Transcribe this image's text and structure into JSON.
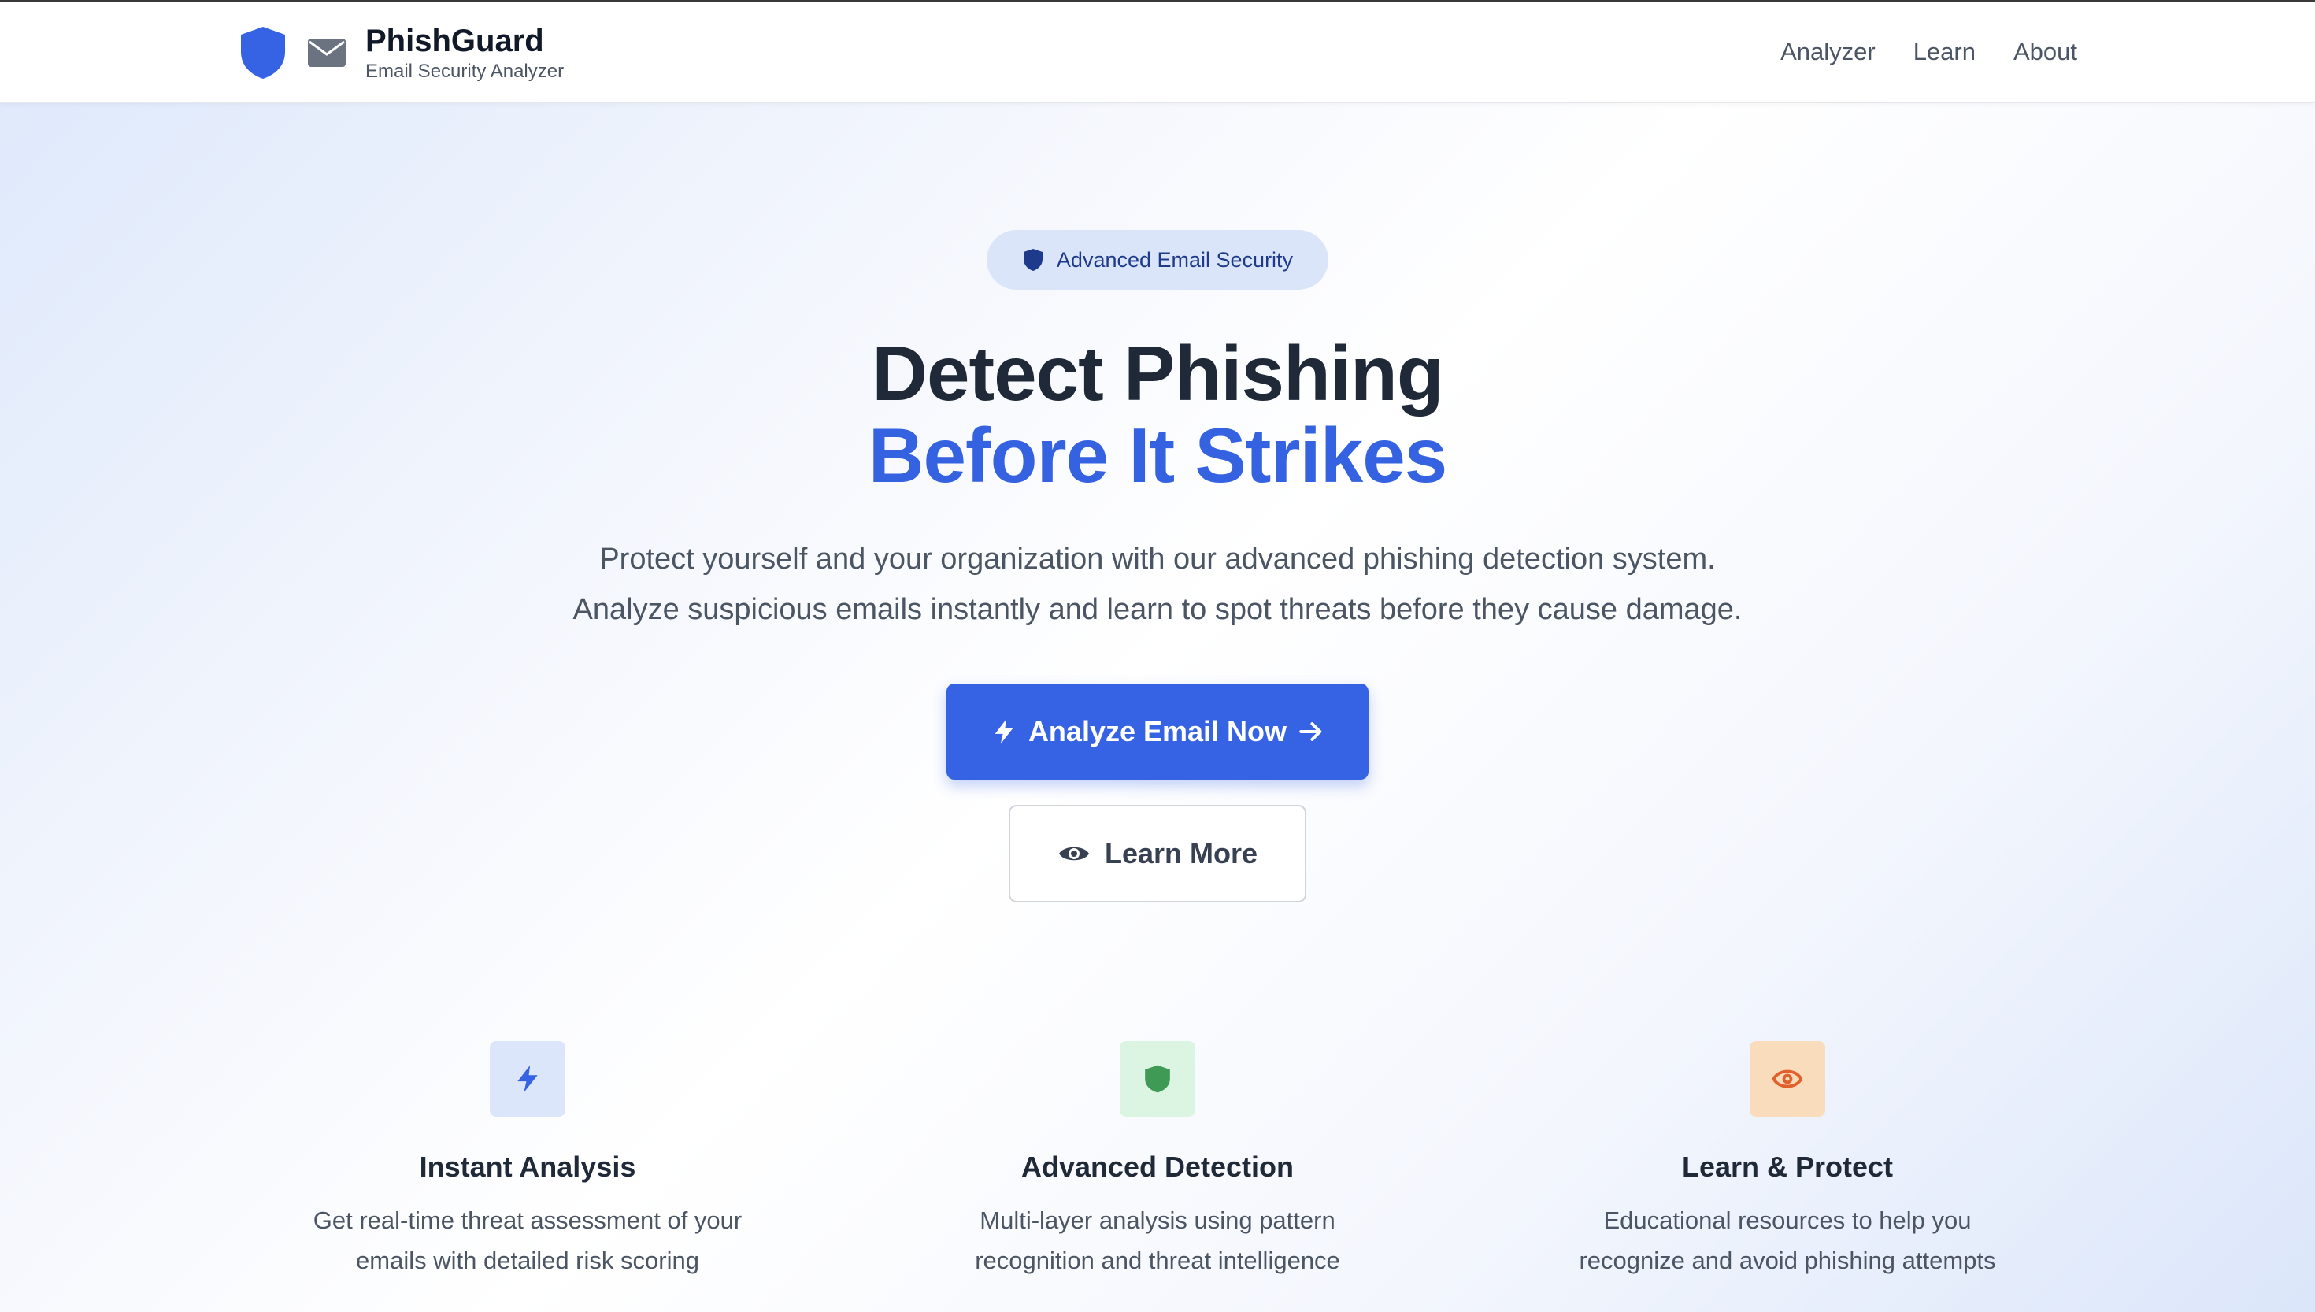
{
  "brand": {
    "title": "PhishGuard",
    "subtitle": "Email Security Analyzer",
    "icons": [
      "shield-icon",
      "mail-icon"
    ],
    "accent_color": "#3462e0"
  },
  "nav": {
    "items": [
      {
        "label": "Analyzer"
      },
      {
        "label": "Learn"
      },
      {
        "label": "About"
      }
    ]
  },
  "hero": {
    "badge": {
      "label": "Advanced Email Security",
      "icon": "shield-icon"
    },
    "headline_line1": "Detect Phishing",
    "headline_line2": "Before It Strikes",
    "description_line1": "Protect yourself and your organization with our advanced phishing detection system.",
    "description_line2": "Analyze suspicious emails instantly and learn to spot threats before they cause damage.",
    "primary_button": {
      "label": "Analyze Email Now",
      "icons": [
        "lightning-icon",
        "arrow-right-icon"
      ]
    },
    "secondary_button": {
      "label": "Learn More",
      "icon": "eye-icon"
    }
  },
  "features": [
    {
      "title": "Instant Analysis",
      "line1": "Get real-time threat assessment of your",
      "line2": "emails with detailed risk scoring",
      "icon": "lightning-icon",
      "color": "#3563e4",
      "bg": "#dce6fa"
    },
    {
      "title": "Advanced Detection",
      "line1": "Multi-layer analysis using pattern",
      "line2": "recognition and threat intelligence",
      "icon": "shield-icon",
      "color": "#3f9a55",
      "bg": "#dcf5e2"
    },
    {
      "title": "Learn & Protect",
      "line1": "Educational resources to help you",
      "line2": "recognize and avoid phishing attempts",
      "icon": "eye-icon",
      "color": "#e0612d",
      "bg": "#f8dcbc"
    }
  ]
}
